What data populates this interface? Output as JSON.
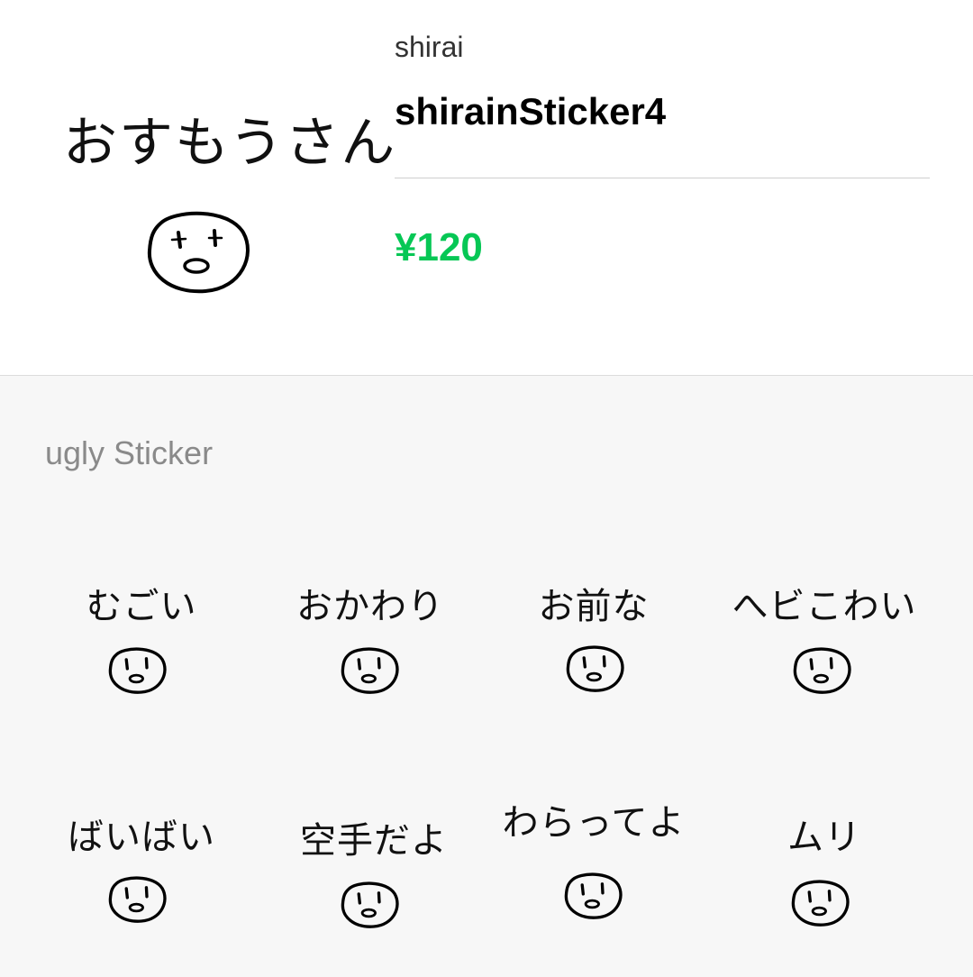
{
  "header": {
    "main_sticker_caption": "おすもうさん",
    "author": "shirai",
    "title": "shirainSticker4",
    "price": "¥120",
    "price_color": "#06c755"
  },
  "section": {
    "title": "ugly Sticker"
  },
  "stickers": [
    {
      "caption": "むごい"
    },
    {
      "caption": "おかわり"
    },
    {
      "caption": "お前な"
    },
    {
      "caption": "へビこわい"
    },
    {
      "caption": "ばいばい"
    },
    {
      "caption": "空手だよ"
    },
    {
      "caption": "わらってよ"
    },
    {
      "caption": "ムリ"
    }
  ],
  "icons": {
    "face": "doodle-face-icon"
  }
}
